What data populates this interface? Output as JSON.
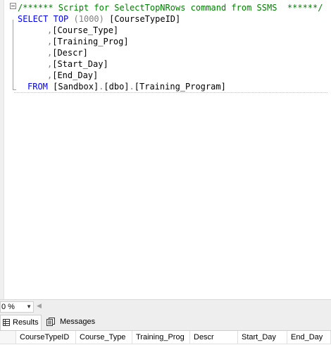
{
  "editor": {
    "comment_line": "/****** Script for SelectTopNRows command from SSMS  ******/",
    "line1": {
      "kw1": "SELECT",
      "kw2": "TOP",
      "paren": "(1000)",
      "col": "[CourseTypeID]"
    },
    "columns": [
      "[Course_Type]",
      "[Training_Prog]",
      "[Descr]",
      "[Start_Day]",
      "[End_Day]"
    ],
    "from_kw": "FROM",
    "db": "[Sandbox]",
    "schema": "[dbo]",
    "table": "[Training_Program]"
  },
  "status": {
    "zoom": "0 %"
  },
  "tabs": {
    "results": "Results",
    "messages": "Messages"
  },
  "grid": {
    "headers": [
      "CourseTypeID",
      "Course_Type",
      "Training_Prog",
      "Descr",
      "Start_Day",
      "End_Day"
    ]
  },
  "colors": {
    "keyword": "#0000ff",
    "comment": "#008000",
    "punct": "#808080"
  }
}
